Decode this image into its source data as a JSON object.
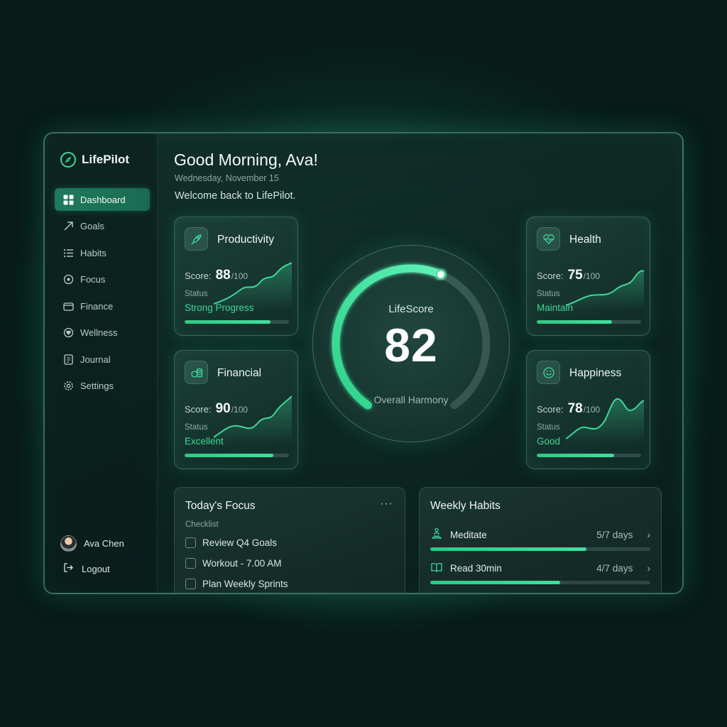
{
  "app": {
    "name": "LifePilot"
  },
  "nav": [
    {
      "label": "Dashboard",
      "icon": "grid-icon",
      "active": true
    },
    {
      "label": "Goals",
      "icon": "arrow-up-right-icon"
    },
    {
      "label": "Habits",
      "icon": "dots-list-icon"
    },
    {
      "label": "Focus",
      "icon": "target-icon"
    },
    {
      "label": "Finance",
      "icon": "wallet-icon"
    },
    {
      "label": "Wellness",
      "icon": "heart-leaf-icon"
    },
    {
      "label": "Journal",
      "icon": "notebook-icon"
    },
    {
      "label": "Settings",
      "icon": "gear-icon"
    }
  ],
  "user": {
    "name": "Ava Chen",
    "logout_label": "Logout"
  },
  "header": {
    "greeting": "Good Morning, Ava!",
    "date": "Wednesday, November 15",
    "welcome": "Welcome back to LifePilot."
  },
  "cards": {
    "productivity": {
      "title": "Productivity",
      "score_label": "Score:",
      "score": "88",
      "max": "/100",
      "status_label": "Status",
      "status": "Strong Progress",
      "progress": 0.82
    },
    "financial": {
      "title": "Financial",
      "score_label": "Score:",
      "score": "90",
      "max": "/100",
      "status_label": "Status",
      "status": "Excellent",
      "progress": 0.85
    },
    "health": {
      "title": "Health",
      "score_label": "Score:",
      "score": "75",
      "max": "/100",
      "status_label": "Status",
      "status": "Maintain",
      "progress": 0.72
    },
    "happiness": {
      "title": "Happiness",
      "score_label": "Score:",
      "score": "78",
      "max": "/100",
      "status_label": "Status",
      "status": "Good",
      "progress": 0.74
    }
  },
  "lifescore": {
    "label": "LifeScore",
    "value": "82",
    "subtitle": "Overall Harmony",
    "fraction": 0.82
  },
  "focus": {
    "title": "Today's Focus",
    "menu": "···",
    "checklist_label": "Checklist",
    "items": [
      "Review Q4 Goals",
      "Workout - 7.00 AM",
      "Plan Weekly Sprints"
    ]
  },
  "habits": {
    "title": "Weekly Habits",
    "items": [
      {
        "name": "Meditate",
        "days": "5/7 days",
        "progress": 0.71,
        "icon": "meditation-icon"
      },
      {
        "name": "Read 30min",
        "days": "4/7 days",
        "progress": 0.59,
        "icon": "book-icon"
      }
    ]
  },
  "colors": {
    "accent": "#3fd79a",
    "background": "#0a2721"
  }
}
